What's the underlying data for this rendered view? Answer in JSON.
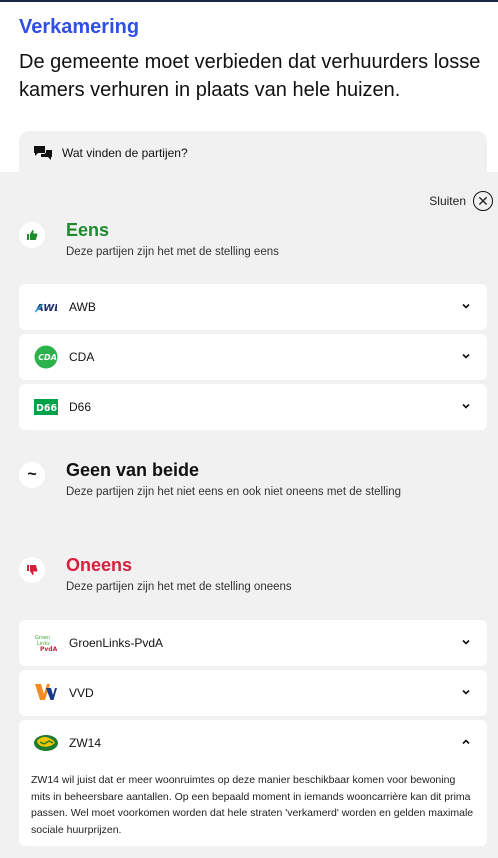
{
  "topic": "Verkamering",
  "statement": "De gemeente moet verbieden dat verhuurders losse kamers verhuren in plaats van hele huizen.",
  "partijen_tab": {
    "label": "Wat vinden de partijen?",
    "icon": "chat-bubbles-icon"
  },
  "close": {
    "label": "Sluiten",
    "icon": "close-circle-icon"
  },
  "groups": {
    "eens": {
      "title": "Eens",
      "subtitle": "Deze partijen zijn het met de stelling eens",
      "color": "#1f8a2e",
      "icon": "thumbs-up-icon",
      "parties": [
        {
          "name": "AWB",
          "logo": "awb-logo"
        },
        {
          "name": "CDA",
          "logo": "cda-logo"
        },
        {
          "name": "D66",
          "logo": "d66-logo"
        }
      ]
    },
    "geen": {
      "title": "Geen van beide",
      "subtitle": "Deze partijen zijn het niet eens en ook niet oneens met de stelling",
      "color": "#111111",
      "icon": "tilde-icon"
    },
    "oneens": {
      "title": "Oneens",
      "subtitle": "Deze partijen zijn het met de stelling oneens",
      "color": "#d61f3c",
      "icon": "thumbs-down-icon",
      "parties": [
        {
          "name": "GroenLinks-PvdA",
          "logo": "groenlinks-pvda-logo"
        },
        {
          "name": "VVD",
          "logo": "vvd-logo"
        },
        {
          "name": "ZW14",
          "logo": "zw14-logo",
          "expanded": true,
          "text": "ZW14 wil juist dat er meer woonruimtes op deze manier beschikbaar komen voor bewoning mits in beheersbare aantallen. Op een bepaald moment in iemands wooncarrière kan dit prima passen. Wel moet voorkomen worden dat hele straten 'verkamerd' worden en gelden maximale sociale huurprijzen."
        }
      ]
    }
  }
}
